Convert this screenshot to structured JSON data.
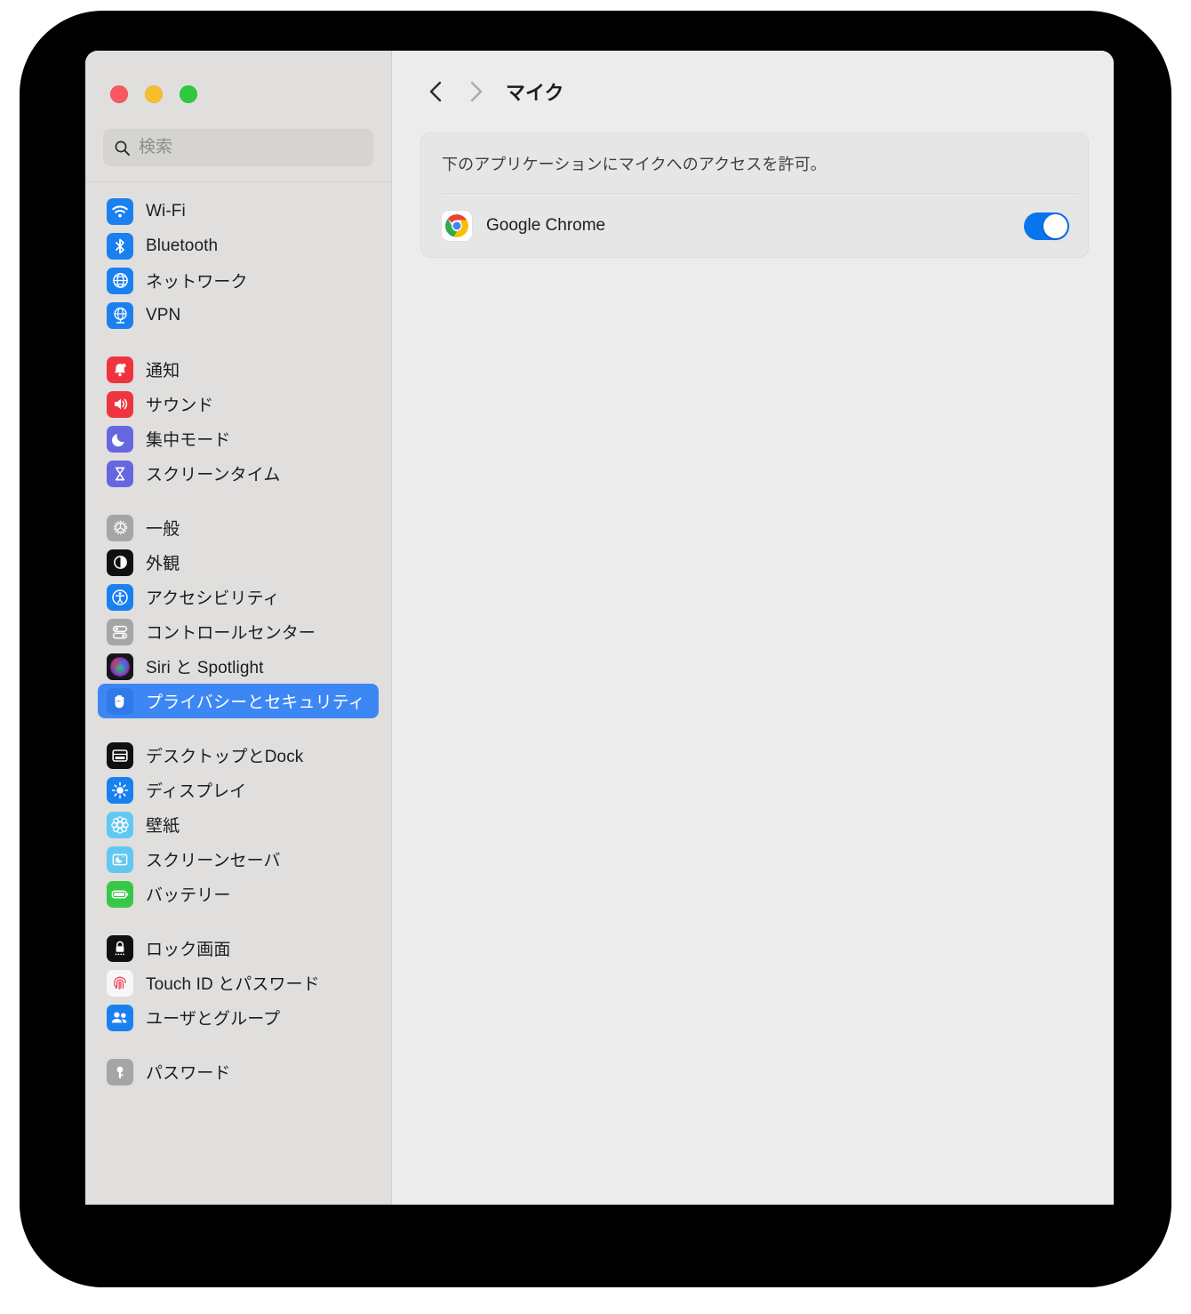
{
  "window": {
    "traffic_lights": [
      {
        "name": "close",
        "color": "#f9585e"
      },
      {
        "name": "minimize",
        "color": "#f8bd2e"
      },
      {
        "name": "zoom",
        "color": "#2dc93f"
      }
    ]
  },
  "sidebar": {
    "search": {
      "placeholder": "検索",
      "value": ""
    },
    "groups": [
      {
        "items": [
          {
            "label": "Wi-Fi",
            "icon": "wifi-icon",
            "color": "#1a80f0",
            "selected": false
          },
          {
            "label": "Bluetooth",
            "icon": "bluetooth-icon",
            "color": "#1a80f0",
            "selected": false
          },
          {
            "label": "ネットワーク",
            "icon": "network-globe-icon",
            "color": "#1a80f0",
            "selected": false
          },
          {
            "label": "VPN",
            "icon": "vpn-globe-icon",
            "color": "#1a80f0",
            "selected": false
          }
        ]
      },
      {
        "items": [
          {
            "label": "通知",
            "icon": "bell-icon",
            "color": "#f0343f",
            "selected": false
          },
          {
            "label": "サウンド",
            "icon": "speaker-icon",
            "color": "#f0343f",
            "selected": false
          },
          {
            "label": "集中モード",
            "icon": "moon-icon",
            "color": "#6667df",
            "selected": false
          },
          {
            "label": "スクリーンタイム",
            "icon": "hourglass-icon",
            "color": "#6667df",
            "selected": false
          }
        ]
      },
      {
        "items": [
          {
            "label": "一般",
            "icon": "gear-icon",
            "color": "#a5a5a8",
            "selected": false
          },
          {
            "label": "外観",
            "icon": "appearance-icon",
            "color": "#101010",
            "selected": false
          },
          {
            "label": "アクセシビリティ",
            "icon": "accessibility-icon",
            "color": "#1a80f0",
            "selected": false
          },
          {
            "label": "コントロールセンター",
            "icon": "control-center-icon",
            "color": "#a5a5a8",
            "selected": false
          },
          {
            "label": "Siri と Spotlight",
            "icon": "siri-icon",
            "color": "#1a1a22",
            "selected": false
          },
          {
            "label": "プライバシーとセキュリティ",
            "icon": "hand-privacy-icon",
            "color": "#1a80f0",
            "selected": true
          }
        ]
      },
      {
        "items": [
          {
            "label": "デスクトップとDock",
            "icon": "desktop-dock-icon",
            "color": "#101010",
            "selected": false
          },
          {
            "label": "ディスプレイ",
            "icon": "brightness-icon",
            "color": "#1a80f0",
            "selected": false
          },
          {
            "label": "壁紙",
            "icon": "wallpaper-icon",
            "color": "#62c8f2",
            "selected": false
          },
          {
            "label": "スクリーンセーバ",
            "icon": "screensaver-icon",
            "color": "#62c8f2",
            "selected": false
          },
          {
            "label": "バッテリー",
            "icon": "battery-icon",
            "color": "#37c84a",
            "selected": false
          }
        ]
      },
      {
        "items": [
          {
            "label": "ロック画面",
            "icon": "lock-screen-icon",
            "color": "#101010",
            "selected": false
          },
          {
            "label": "Touch ID とパスワード",
            "icon": "touch-id-icon",
            "color": "#f7f7f7",
            "selected": false
          },
          {
            "label": "ユーザとグループ",
            "icon": "users-groups-icon",
            "color": "#1a80f0",
            "selected": false
          }
        ]
      },
      {
        "items": [
          {
            "label": "パスワード",
            "icon": "key-icon",
            "color": "#a5a5a8",
            "selected": false
          }
        ]
      }
    ]
  },
  "content": {
    "nav": {
      "back_label": "‹",
      "forward_label": "›"
    },
    "title": "マイク",
    "card": {
      "description": "下のアプリケーションにマイクへのアクセスを許可。",
      "apps": [
        {
          "name": "Google Chrome",
          "icon": "chrome-icon",
          "enabled": true
        }
      ]
    }
  },
  "colors": {
    "accent": "#3d87f5",
    "toggle_on": "#0a74ef",
    "sidebar_bg": "#e0dfdd",
    "content_bg": "#ececec",
    "card_bg": "#e6e6e6"
  }
}
